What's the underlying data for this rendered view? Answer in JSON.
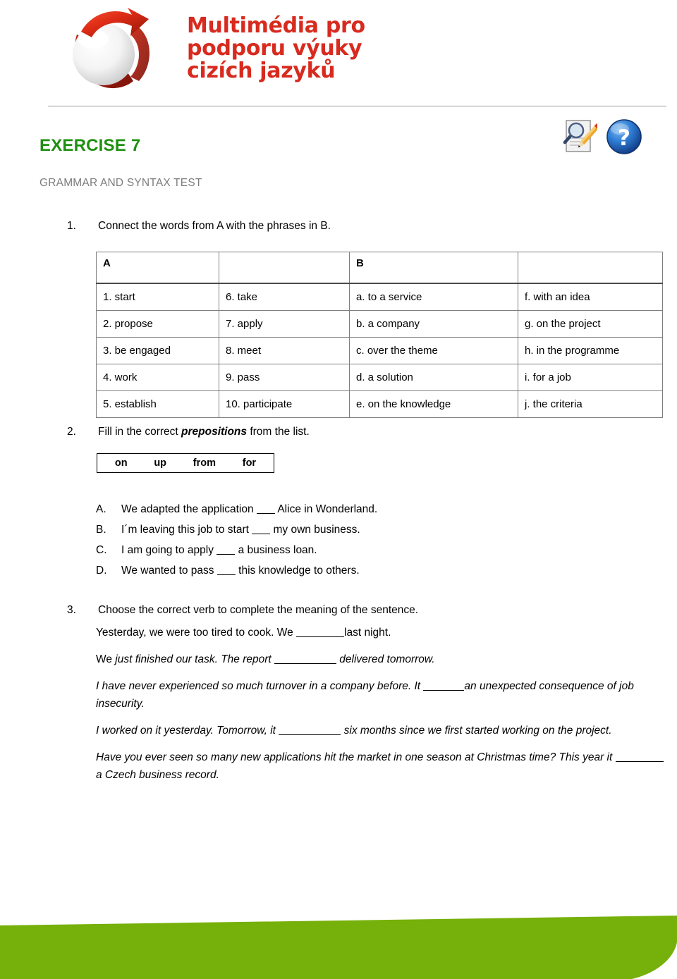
{
  "logo": {
    "line1": "Multimédia pro",
    "line2": "podporu výuky",
    "line3": "cizích jazyků",
    "mark_icon": "sphere-arrow-logo-icon",
    "brand_color": "#d82a1e"
  },
  "header": {
    "icons": [
      {
        "name": "document-review-icon",
        "label": "document with magnifier and pencil"
      },
      {
        "name": "help-question-icon",
        "label": "blue question mark"
      }
    ]
  },
  "title": {
    "exercise": "EXERCISE 7",
    "subtitle": "GRAMMAR AND SYNTAX TEST",
    "accent_color": "#1E9010",
    "subtitle_color": "#7d7d7d"
  },
  "task1": {
    "number": "1.",
    "instruction_pre": "Connect the words from A with the phrases in B.",
    "headers": [
      "A",
      "",
      "B",
      ""
    ],
    "rows": [
      [
        "1. start",
        "6. take",
        "a. to a service",
        "f. with an idea"
      ],
      [
        "2. propose",
        "7. apply",
        "b. a company",
        "g. on the project"
      ],
      [
        "3. be engaged",
        "8. meet",
        "c. over the theme",
        "h. in the programme"
      ],
      [
        "4. work",
        "9. pass",
        "d. a solution",
        "i. for a job"
      ],
      [
        "5. establish",
        "10. participate",
        "e. on the knowledge",
        "j. the criteria"
      ]
    ]
  },
  "task2": {
    "number": "2.",
    "instruction_a": "Fill in the correct ",
    "instruction_bold": "prepositions",
    "instruction_b": " from the list.",
    "word_bank": [
      "on",
      "up",
      "from",
      "for"
    ],
    "items": [
      {
        "letter": "A.",
        "pre": "We adapted the application ",
        "post": " Alice in Wonderland."
      },
      {
        "letter": "B.",
        "pre": "I´m leaving this job to start ",
        "post": " my own business."
      },
      {
        "letter": "C.",
        "pre": "I am going to apply ",
        "post": " a business loan."
      },
      {
        "letter": "D.",
        "pre": "We wanted to pass ",
        "post": " this knowledge to others."
      }
    ]
  },
  "task3": {
    "number": "3.",
    "instruction": "Choose the correct verb to complete the meaning of the sentence.",
    "s1_a": "Yesterday, we were too tired to cook. We ",
    "s1_b": "last night.",
    "s2_lead": "We ",
    "s2_a": "just finished our task. The report ",
    "s2_b": " delivered tomorrow.",
    "s3_a": "I have never experienced so much turnover in a company before. It ",
    "s3_b": "an unexpected consequence of job insecurity.",
    "s4_a": "I worked on it yesterday. Tomorrow, it ",
    "s4_b": " six months since we first started working on the project.",
    "s5_a": "Have you ever seen so many new applications hit the market in one season at Christmas time? This year it ",
    "s5_b": " a Czech business record."
  },
  "footer": {
    "band_color": "#76b00a",
    "decor": "green-angled-footer-band"
  }
}
